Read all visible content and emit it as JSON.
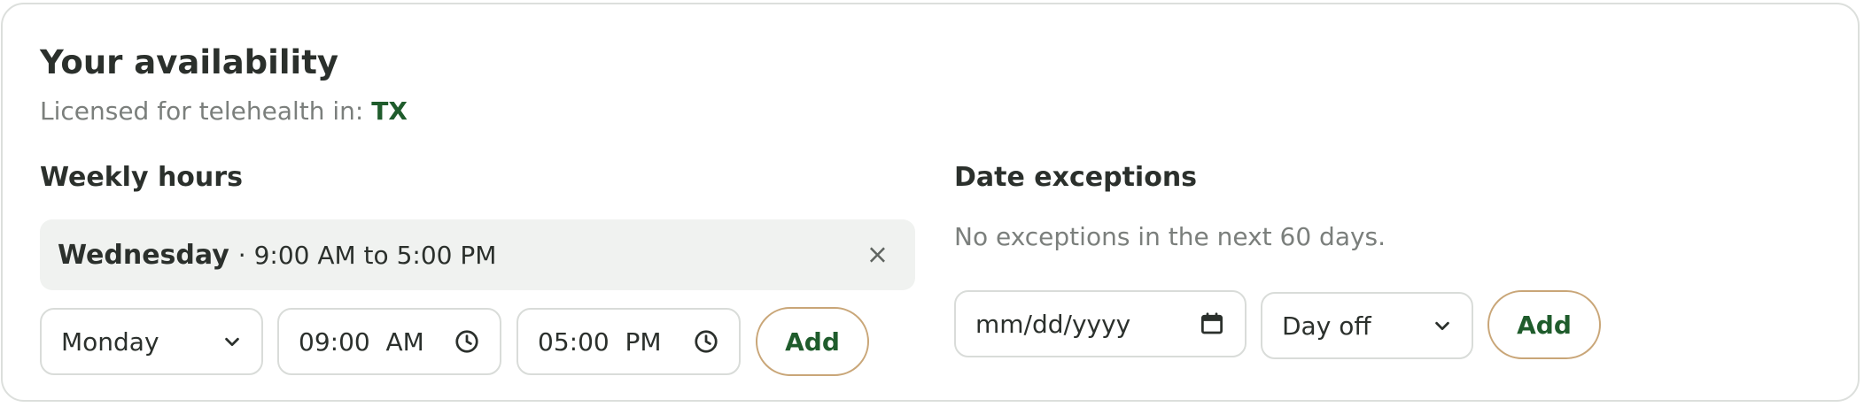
{
  "availability": {
    "title": "Your availability",
    "license_prefix": "Licensed for telehealth in: ",
    "license_state": "TX"
  },
  "weekly": {
    "heading": "Weekly hours",
    "entries": [
      {
        "day": "Wednesday",
        "range": "· 9:00 AM to 5:00 PM",
        "remove_glyph": "×"
      }
    ],
    "form": {
      "day_selected": "Monday",
      "start_time": "09:00  AM",
      "end_time": "05:00  PM",
      "add_label": "Add"
    }
  },
  "exceptions": {
    "heading": "Date exceptions",
    "empty_text": "No exceptions in the next 60 days.",
    "form": {
      "date_placeholder": "mm/dd/yyyy",
      "type_selected": "Day off",
      "add_label": "Add"
    }
  },
  "colors": {
    "accent_green": "#1f5c2c",
    "button_border": "#c9a678",
    "row_background": "#f0f2f0"
  }
}
